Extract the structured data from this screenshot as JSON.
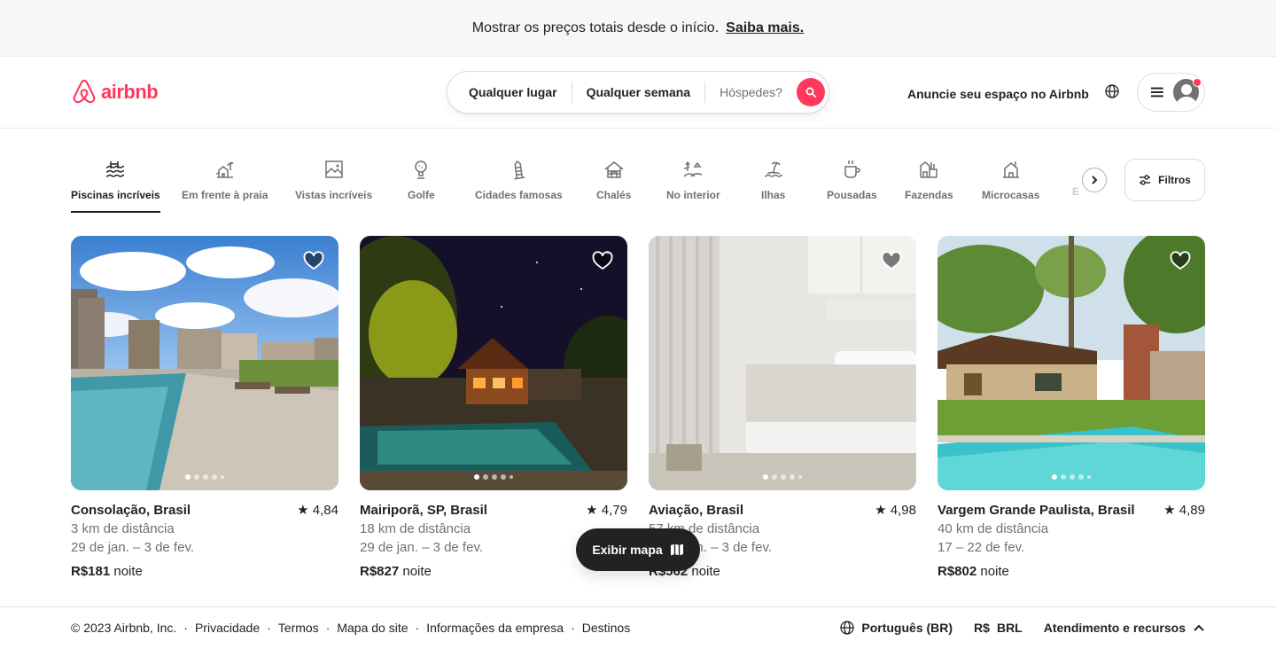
{
  "banner": {
    "text": "Mostrar os preços totais desde o início.",
    "link": "Saiba mais."
  },
  "header": {
    "logo_text": "airbnb",
    "search": {
      "where": "Qualquer lugar",
      "when": "Qualquer semana",
      "guests": "Hóspedes?"
    },
    "host_link": "Anuncie seu espaço no Airbnb"
  },
  "categories": [
    {
      "label": "Piscinas incríveis",
      "icon": "pool-icon",
      "active": true
    },
    {
      "label": "Em frente à praia",
      "icon": "beachfront-icon"
    },
    {
      "label": "Vistas incríveis",
      "icon": "views-icon"
    },
    {
      "label": "Golfe",
      "icon": "golf-icon"
    },
    {
      "label": "Cidades famosas",
      "icon": "iconic-city-icon"
    },
    {
      "label": "Chalés",
      "icon": "cabin-icon"
    },
    {
      "label": "No interior",
      "icon": "countryside-icon"
    },
    {
      "label": "Ilhas",
      "icon": "island-icon"
    },
    {
      "label": "Pousadas",
      "icon": "bed-breakfast-icon"
    },
    {
      "label": "Fazendas",
      "icon": "farm-icon"
    },
    {
      "label": "Microcasas",
      "icon": "tiny-home-icon"
    },
    {
      "label": "E",
      "icon": ""
    }
  ],
  "filters_label": "Filtros",
  "listings": [
    {
      "title": "Consolação, Brasil",
      "rating": "4,84",
      "distance": "3 km de distância",
      "dates": "29 de jan. – 3 de fev.",
      "price": "R$181",
      "unit": "noite"
    },
    {
      "title": "Mairiporã, SP, Brasil",
      "rating": "4,79",
      "distance": "18 km de distância",
      "dates": "29 de jan. – 3 de fev.",
      "price": "R$827",
      "unit": "noite"
    },
    {
      "title": "Aviação, Brasil",
      "rating": "4,98",
      "distance": "57 km de distância",
      "dates": "29 de jan. – 3 de fev.",
      "price": "R$562",
      "unit": "noite"
    },
    {
      "title": "Vargem Grande Paulista, Brasil",
      "rating": "4,89",
      "distance": "40 km de distância",
      "dates": "17 – 22 de fev.",
      "price": "R$802",
      "unit": "noite"
    }
  ],
  "map_button": "Exibir mapa",
  "footer": {
    "links": [
      "© 2023 Airbnb, Inc.",
      "Privacidade",
      "Termos",
      "Mapa do site",
      "Informações da empresa",
      "Destinos"
    ],
    "language": "Português (BR)",
    "currency_symbol": "R$",
    "currency": "BRL",
    "support": "Atendimento e recursos"
  },
  "colors": {
    "brand": "#ff385c",
    "text": "#222222",
    "muted": "#717171"
  }
}
